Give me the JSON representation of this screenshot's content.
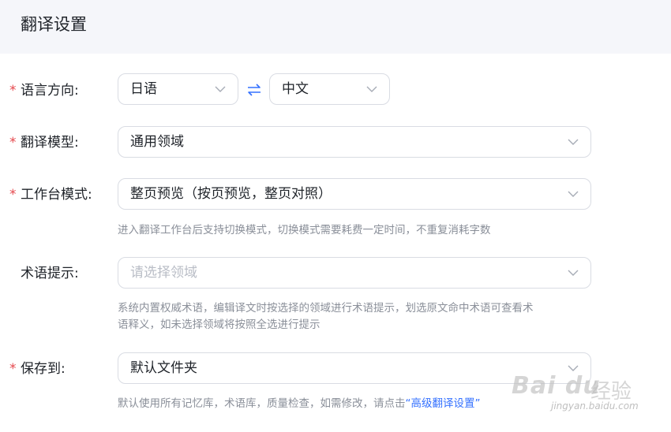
{
  "header": {
    "title": "翻译设置"
  },
  "form": {
    "language_direction": {
      "label": "语言方向:",
      "source_value": "日语",
      "target_value": "中文",
      "swap_icon": "swap-arrows-icon"
    },
    "translation_model": {
      "label": "翻译模型:",
      "value": "通用领域"
    },
    "workbench_mode": {
      "label": "工作台模式:",
      "value": "整页预览（按页预览，整页对照）",
      "hint": "进入翻译工作台后支持切换模式，切换模式需要耗费一定时间，不重复消耗字数"
    },
    "term_hint": {
      "label": "术语提示:",
      "placeholder": "请选择领域",
      "hint_line1": "系统内置权威术语，编辑译文时按选择的领域进行术语提示，划选原文命中术语可查看术",
      "hint_line2": "语释义，如未选择领域将按照全选进行提示"
    },
    "save_to": {
      "label": "保存到:",
      "value": "默认文件夹",
      "hint_prefix": "默认使用所有记忆库，术语库，质量检查，如需修改，请点击",
      "hint_link": "“高级翻译设置”"
    },
    "required_mark": "*"
  },
  "watermark": {
    "logo": "Bai du",
    "text": "经验",
    "url": "jingyan.baidu.com"
  },
  "colors": {
    "required": "#e5484d",
    "link": "#3370ff",
    "swap": "#3370ff",
    "header_bg": "#f5f6fa"
  }
}
